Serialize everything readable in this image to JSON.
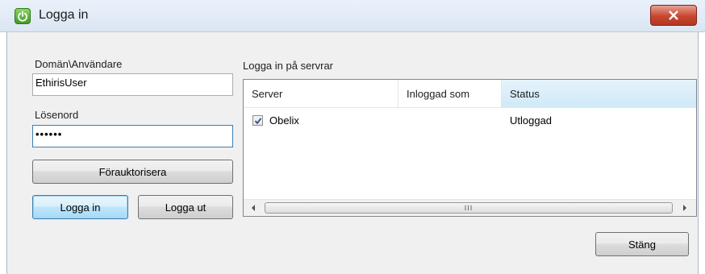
{
  "window": {
    "title": "Logga in"
  },
  "icons": {
    "app": "power-icon",
    "close": "close-icon",
    "check": "checkmark-icon",
    "scroll_left": "arrow-left-icon",
    "scroll_right": "arrow-right-icon"
  },
  "form": {
    "domain_user_label": "Domän\\Användare",
    "domain_user_value": "EthirisUser",
    "password_label": "Lösenord",
    "password_value": "••••••",
    "preauthorize_label": "Förauktorisera",
    "login_label": "Logga in",
    "logout_label": "Logga ut"
  },
  "servers": {
    "group_label": "Logga in på servrar",
    "columns": [
      "Server",
      "Inloggad som",
      "Status"
    ],
    "rows": [
      {
        "checked": true,
        "server": "Obelix",
        "logged_in_as": "",
        "status": "Utloggad"
      }
    ],
    "scroll_thumb_text": "III"
  },
  "footer": {
    "close_label": "Stäng"
  },
  "colors": {
    "accent": "#3c7fb1",
    "close_button": "#c8462f",
    "header_highlight": "#cfe9f8"
  }
}
